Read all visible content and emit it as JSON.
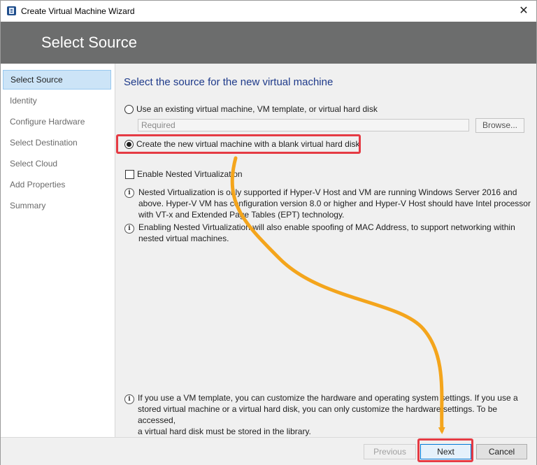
{
  "window": {
    "title": "Create Virtual Machine Wizard",
    "close_glyph": "✕"
  },
  "header": {
    "title": "Select Source"
  },
  "sidebar": {
    "items": [
      {
        "label": "Select Source",
        "active": true
      },
      {
        "label": "Identity"
      },
      {
        "label": "Configure Hardware"
      },
      {
        "label": "Select Destination"
      },
      {
        "label": "Select Cloud"
      },
      {
        "label": "Add Properties"
      },
      {
        "label": "Summary"
      }
    ]
  },
  "main": {
    "section_title": "Select the source for the new virtual machine",
    "option_existing": "Use an existing virtual machine, VM template, or virtual hard disk",
    "source_input_placeholder": "Required",
    "browse_label": "Browse...",
    "option_new": "Create the new virtual machine with a blank virtual hard disk",
    "nested_checkbox_label": "Enable Nested Virtualization",
    "info1_line1": "Nested Virtualization is only supported if Hyper-V Host and VM are running Windows Server 2016 and",
    "info1_line2": "above. Hyper-V VM has configuration version 8.0 or higher and Hyper-V Host should have Intel processor",
    "info1_line3": "with VT-x and Extended Page Tables (EPT) technology.",
    "info2_line1": "Enabling Nested Virtualization will also enable spoofing of MAC Address, to support networking within",
    "info2_line2": "nested virtual machines.",
    "info3_line1": "If you use a VM template, you can customize the hardware and operating system settings. If you use a",
    "info3_line2": "stored virtual machine or a virtual hard disk, you can only customize the hardware settings. To be accessed,",
    "info3_line3": "a virtual hard disk must be stored in the library."
  },
  "footer": {
    "previous_label": "Previous",
    "next_label": "Next",
    "cancel_label": "Cancel"
  },
  "colors": {
    "header_bg": "#6c6d6d",
    "highlight": "#e53b44",
    "arrow": "#f4a51c",
    "title_blue": "#1e3a8a",
    "selected_nav": "#cce4f7"
  },
  "icons": {
    "app": "virtual-machine-manager-icon",
    "info": "info-icon",
    "close": "close-icon"
  }
}
